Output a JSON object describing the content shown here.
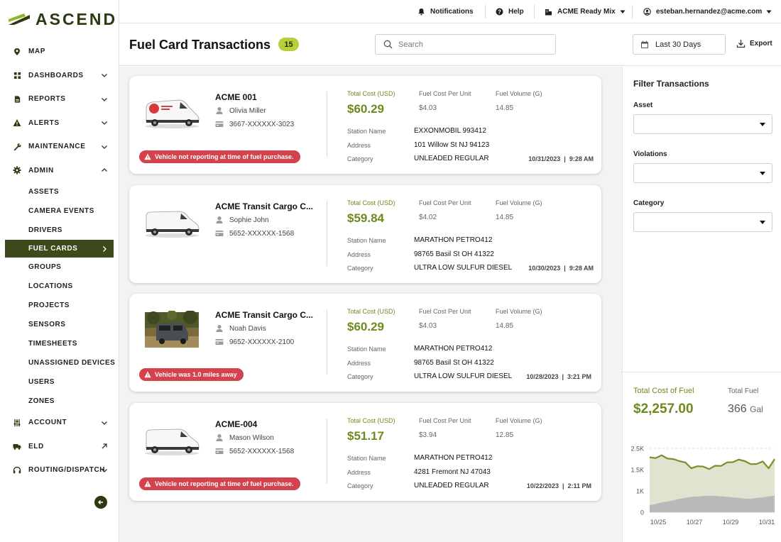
{
  "brand": {
    "name": "ASCEND"
  },
  "topbar": {
    "notifications": "Notifications",
    "help": "Help",
    "company": "ACME Ready Mix",
    "user": "esteban.hernandez@acme.com"
  },
  "sidebar": {
    "items": [
      {
        "label": "MAP",
        "icon": "map-pin-icon"
      },
      {
        "label": "DASHBOARDS",
        "icon": "grid-icon"
      },
      {
        "label": "REPORTS",
        "icon": "document-icon"
      },
      {
        "label": "ALERTS",
        "icon": "warning-icon"
      },
      {
        "label": "MAINTENANCE",
        "icon": "wrench-icon"
      },
      {
        "label": "ADMIN",
        "icon": "gear-icon"
      }
    ],
    "admin_sub": [
      "ASSETS",
      "CAMERA EVENTS",
      "DRIVERS",
      "FUEL CARDS",
      "GROUPS",
      "LOCATIONS",
      "PROJECTS",
      "SENSORS",
      "TIMESHEETS",
      "UNASSIGNED DEVICES",
      "USERS",
      "ZONES"
    ],
    "active_sub": "FUEL CARDS",
    "bottom": [
      {
        "label": "ACCOUNT",
        "icon": "sliders-icon"
      },
      {
        "label": "ELD",
        "icon": "truck-icon"
      },
      {
        "label": "ROUTING/DISPATCH",
        "icon": "headset-icon"
      }
    ]
  },
  "header": {
    "title": "Fuel Card Transactions",
    "count": "15",
    "search_placeholder": "Search",
    "date_range": "Last 30 Days",
    "export": "Export"
  },
  "labels": {
    "total_cost": "Total Cost (USD)",
    "cost_per_unit": "Fuel Cost Per Unit",
    "volume": "Fuel Volume (G)",
    "station": "Station Name",
    "address": "Address",
    "category": "Category"
  },
  "transactions": [
    {
      "asset": "ACME 001",
      "driver": "Olivia Miller",
      "card": "3667-XXXXXX-3023",
      "total": "$60.29",
      "unit": "$4.03",
      "volume": "14.85",
      "station": "EXXONMOBIL 993412",
      "address": "101 Willow St NJ 94123",
      "category": "UNLEADED REGULAR",
      "timestamp": "10/31/2023  |  9:28 AM",
      "alert": "Vehicle not reporting at time of fuel purchase."
    },
    {
      "asset": "ACME Transit Cargo C...",
      "driver": "Sophie John",
      "card": "5652-XXXXXX-1568",
      "total": "$59.84",
      "unit": "$4.02",
      "volume": "14.85",
      "station": "MARATHON PETRO412",
      "address": "98765 Basil St OH 41322",
      "category": "ULTRA LOW SULFUR DIESEL",
      "timestamp": "10/30/2023  |  9:28 AM",
      "alert": ""
    },
    {
      "asset": "ACME Transit Cargo C...",
      "driver": "Noah Davis",
      "card": "9652-XXXXXX-2100",
      "total": "$60.29",
      "unit": "$4.03",
      "volume": "14.85",
      "station": "MARATHON PETRO412",
      "address": "98765 Basil St OH 41322",
      "category": "ULTRA LOW SULFUR DIESEL",
      "timestamp": "10/28/2023  |  3:21 PM",
      "alert": "Vehicle was 1.0 miles away"
    },
    {
      "asset": "ACME-004",
      "driver": "Mason Wilson",
      "card": "5652-XXXXXX-1568",
      "total": "$51.17",
      "unit": "$3.94",
      "volume": "12.85",
      "station": "MARATHON PETRO412",
      "address": "4281 Fremont NJ 47043",
      "category": "UNLEADED REGULAR",
      "timestamp": "10/22/2023  |  2:11 PM",
      "alert": "Vehicle not reporting at time of fuel purchase."
    }
  ],
  "filters": {
    "title": "Filter Transactions",
    "asset": "Asset",
    "violations": "Violations",
    "category": "Category"
  },
  "summary": {
    "total_cost_label": "Total Cost of Fuel",
    "total_cost": "$2,257.00",
    "total_fuel_label": "Total Fuel",
    "total_fuel": "366",
    "total_fuel_unit": "Gal"
  },
  "chart_data": {
    "type": "area",
    "y_ticks": [
      "2.5K",
      "1.5K",
      "1K",
      "0"
    ],
    "x_ticks": [
      "10/25",
      "10/27",
      "10/29",
      "10/31"
    ],
    "colors": {
      "cost_line": "#7a8f2a",
      "cost_fill": "#dfe3d0",
      "fuel_fill": "#b9b9b9"
    },
    "series": [
      {
        "values": [
          2150,
          2120,
          2230,
          2100,
          2080,
          2000,
          1950,
          1720,
          1800,
          1790,
          1690,
          1820,
          1810,
          1950,
          1960,
          2060,
          2000,
          1880,
          1890,
          1990,
          1720,
          2080
        ]
      },
      {
        "values": [
          270,
          320,
          380,
          420,
          470,
          520,
          560,
          600,
          610,
          630,
          650,
          640,
          620,
          600,
          580,
          560,
          530,
          520,
          560,
          580,
          620,
          650
        ]
      }
    ]
  }
}
